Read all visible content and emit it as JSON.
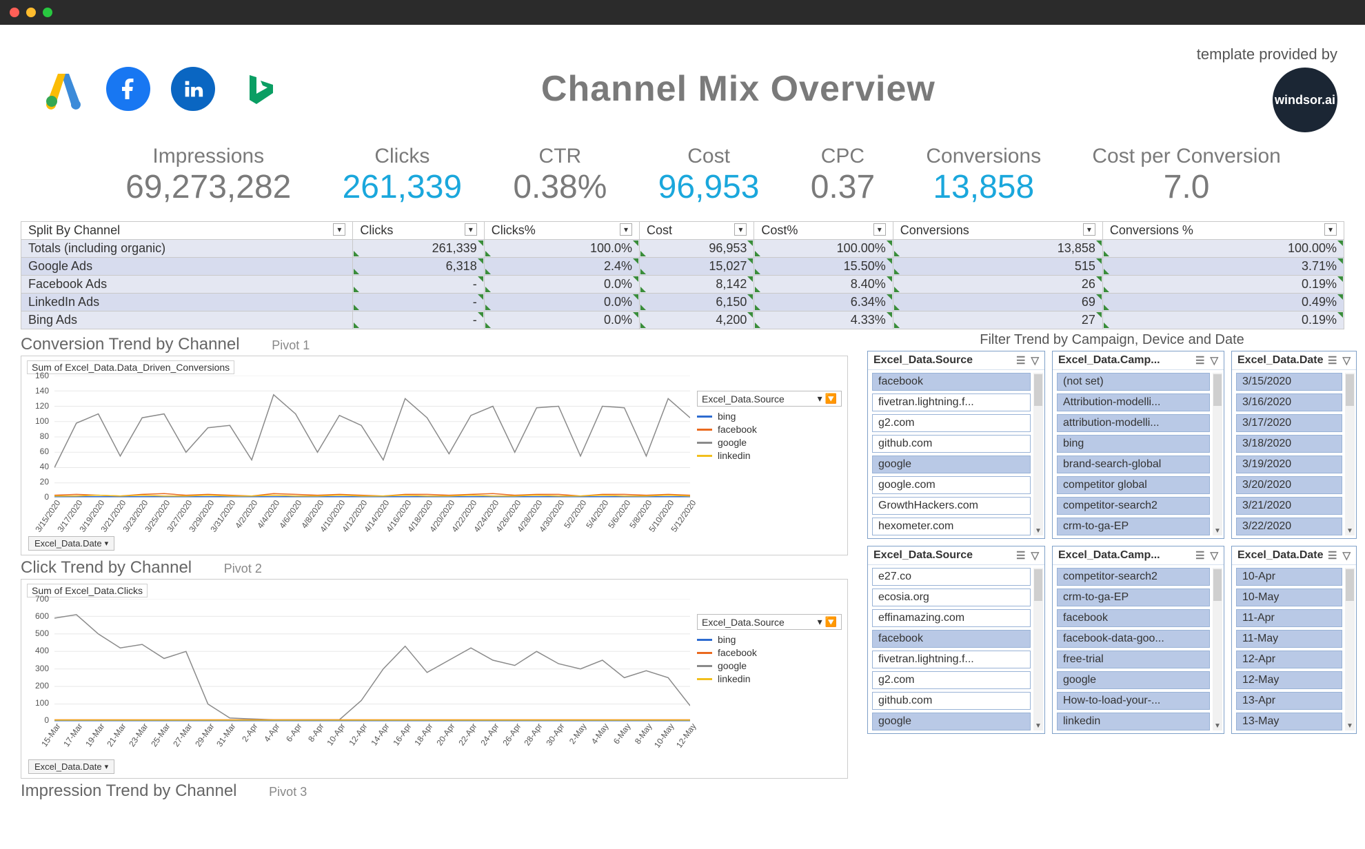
{
  "window": {
    "title": "Channel Mix Overview",
    "provided_label": "template provided by",
    "badge": "windsor.ai"
  },
  "kpis": [
    {
      "label": "Impressions",
      "value": "69,273,282",
      "blue": false
    },
    {
      "label": "Clicks",
      "value": "261,339",
      "blue": true
    },
    {
      "label": "CTR",
      "value": "0.38%",
      "blue": false
    },
    {
      "label": "Cost",
      "value": "96,953",
      "blue": true
    },
    {
      "label": "CPC",
      "value": "0.37",
      "blue": false
    },
    {
      "label": "Conversions",
      "value": "13,858",
      "blue": true
    },
    {
      "label": "Cost per Conversion",
      "value": "7.0",
      "blue": false
    }
  ],
  "table": {
    "headers": [
      "Split By Channel",
      "Clicks",
      "Clicks%",
      "Cost",
      "Cost%",
      "Conversions",
      "Conversions %"
    ],
    "rows": [
      {
        "c": [
          "Totals (including organic)",
          "261,339",
          "100.0%",
          "96,953",
          "100.00%",
          "13,858",
          "100.00%"
        ]
      },
      {
        "c": [
          "Google Ads",
          "6,318",
          "2.4%",
          "15,027",
          "15.50%",
          "515",
          "3.71%"
        ]
      },
      {
        "c": [
          "Facebook Ads",
          "-",
          "0.0%",
          "8,142",
          "8.40%",
          "26",
          "0.19%"
        ]
      },
      {
        "c": [
          "LinkedIn Ads",
          "-",
          "0.0%",
          "6,150",
          "6.34%",
          "69",
          "0.49%"
        ]
      },
      {
        "c": [
          "Bing Ads",
          "-",
          "0.0%",
          "4,200",
          "4.33%",
          "27",
          "0.19%"
        ]
      }
    ]
  },
  "legend_header": "Excel_Data.Source",
  "legend": [
    {
      "name": "bing",
      "color": "#2d6bd0"
    },
    {
      "name": "facebook",
      "color": "#ea6a1f"
    },
    {
      "name": "google",
      "color": "#8a8a8a"
    },
    {
      "name": "linkedin",
      "color": "#f2bf1c"
    }
  ],
  "chart1": {
    "title": "Conversion Trend by Channel",
    "pivot": "Pivot 1",
    "sub": "Sum of Excel_Data.Data_Driven_Conversions",
    "pill": "Excel_Data.Date"
  },
  "chart2": {
    "title": "Click Trend by Channel",
    "pivot": "Pivot 2",
    "sub": "Sum of Excel_Data.Clicks",
    "pill": "Excel_Data.Date"
  },
  "chart3": {
    "title": "Impression Trend by Channel",
    "pivot": "Pivot 3"
  },
  "filters_header": "Filter Trend by Campaign, Device and Date",
  "slicers_top": [
    {
      "title": "Excel_Data.Source",
      "scroll": true,
      "items": [
        {
          "t": "facebook",
          "sel": true
        },
        {
          "t": "fivetran.lightning.f...",
          "sel": false
        },
        {
          "t": "g2.com",
          "sel": false
        },
        {
          "t": "github.com",
          "sel": false
        },
        {
          "t": "google",
          "sel": true
        },
        {
          "t": "google.com",
          "sel": false
        },
        {
          "t": "GrowthHackers.com",
          "sel": false
        },
        {
          "t": "hexometer.com",
          "sel": false
        }
      ]
    },
    {
      "title": "Excel_Data.Camp...",
      "scroll": true,
      "items": [
        {
          "t": "(not set)",
          "sel": true
        },
        {
          "t": "Attribution-modelli...",
          "sel": true
        },
        {
          "t": "attribution-modelli...",
          "sel": true
        },
        {
          "t": "bing",
          "sel": true
        },
        {
          "t": "brand-search-global",
          "sel": true
        },
        {
          "t": "competitor global",
          "sel": true
        },
        {
          "t": "competitor-search2",
          "sel": true
        },
        {
          "t": "crm-to-ga-EP",
          "sel": true
        }
      ]
    },
    {
      "title": "Excel_Data.Date",
      "scroll": true,
      "items": [
        {
          "t": "3/15/2020",
          "sel": true
        },
        {
          "t": "3/16/2020",
          "sel": true
        },
        {
          "t": "3/17/2020",
          "sel": true
        },
        {
          "t": "3/18/2020",
          "sel": true
        },
        {
          "t": "3/19/2020",
          "sel": true
        },
        {
          "t": "3/20/2020",
          "sel": true
        },
        {
          "t": "3/21/2020",
          "sel": true
        },
        {
          "t": "3/22/2020",
          "sel": true
        }
      ]
    }
  ],
  "slicers_bot": [
    {
      "title": "Excel_Data.Source",
      "scroll": true,
      "items": [
        {
          "t": "e27.co",
          "sel": false
        },
        {
          "t": "ecosia.org",
          "sel": false
        },
        {
          "t": "effinamazing.com",
          "sel": false
        },
        {
          "t": "facebook",
          "sel": true
        },
        {
          "t": "fivetran.lightning.f...",
          "sel": false
        },
        {
          "t": "g2.com",
          "sel": false
        },
        {
          "t": "github.com",
          "sel": false
        },
        {
          "t": "google",
          "sel": true
        }
      ]
    },
    {
      "title": "Excel_Data.Camp...",
      "scroll": true,
      "items": [
        {
          "t": "competitor-search2",
          "sel": true
        },
        {
          "t": "crm-to-ga-EP",
          "sel": true
        },
        {
          "t": "facebook",
          "sel": true
        },
        {
          "t": "facebook-data-goo...",
          "sel": true
        },
        {
          "t": "free-trial",
          "sel": true
        },
        {
          "t": "google",
          "sel": true
        },
        {
          "t": "How-to-load-your-...",
          "sel": true
        },
        {
          "t": "linkedin",
          "sel": true
        }
      ]
    },
    {
      "title": "Excel_Data.Date",
      "scroll": true,
      "items": [
        {
          "t": "10-Apr",
          "sel": true
        },
        {
          "t": "10-May",
          "sel": true
        },
        {
          "t": "11-Apr",
          "sel": true
        },
        {
          "t": "11-May",
          "sel": true
        },
        {
          "t": "12-Apr",
          "sel": true
        },
        {
          "t": "12-May",
          "sel": true
        },
        {
          "t": "13-Apr",
          "sel": true
        },
        {
          "t": "13-May",
          "sel": true
        }
      ]
    }
  ],
  "chart_data": [
    {
      "id": "conversion_trend",
      "type": "line",
      "ylim": [
        0,
        160
      ],
      "yticks": [
        0,
        20,
        40,
        60,
        80,
        100,
        120,
        140,
        160
      ],
      "x": [
        "3/15/2020",
        "3/17/2020",
        "3/19/2020",
        "3/21/2020",
        "3/23/2020",
        "3/25/2020",
        "3/27/2020",
        "3/29/2020",
        "3/31/2020",
        "4/2/2020",
        "4/4/2020",
        "4/6/2020",
        "4/8/2020",
        "4/10/2020",
        "4/12/2020",
        "4/14/2020",
        "4/16/2020",
        "4/18/2020",
        "4/20/2020",
        "4/22/2020",
        "4/24/2020",
        "4/26/2020",
        "4/28/2020",
        "4/30/2020",
        "5/2/2020",
        "5/4/2020",
        "5/6/2020",
        "5/8/2020",
        "5/10/2020",
        "5/12/2020"
      ],
      "series": [
        {
          "name": "google",
          "color": "#8a8a8a",
          "values": [
            40,
            98,
            110,
            55,
            105,
            110,
            60,
            92,
            95,
            50,
            135,
            110,
            60,
            108,
            95,
            50,
            130,
            105,
            58,
            108,
            120,
            60,
            118,
            120,
            55,
            120,
            118,
            55,
            130,
            105
          ]
        },
        {
          "name": "bing",
          "color": "#2d6bd0",
          "values": [
            2,
            2,
            2,
            2,
            2,
            2,
            2,
            2,
            2,
            2,
            2,
            2,
            2,
            2,
            2,
            2,
            2,
            2,
            2,
            2,
            2,
            2,
            2,
            2,
            2,
            2,
            2,
            2,
            2,
            2
          ]
        },
        {
          "name": "facebook",
          "color": "#ea6a1f",
          "values": [
            4,
            5,
            4,
            3,
            5,
            6,
            4,
            5,
            4,
            3,
            6,
            5,
            4,
            5,
            4,
            3,
            5,
            5,
            4,
            5,
            6,
            4,
            5,
            5,
            3,
            5,
            5,
            4,
            5,
            4
          ]
        },
        {
          "name": "linkedin",
          "color": "#f2bf1c",
          "values": [
            3,
            3,
            4,
            3,
            4,
            3,
            3,
            4,
            3,
            3,
            4,
            3,
            3,
            4,
            3,
            3,
            4,
            3,
            3,
            4,
            3,
            3,
            4,
            3,
            3,
            4,
            3,
            3,
            4,
            3
          ]
        }
      ]
    },
    {
      "id": "click_trend",
      "type": "line",
      "ylim": [
        0,
        700
      ],
      "yticks": [
        0,
        100,
        200,
        300,
        400,
        500,
        600,
        700
      ],
      "x": [
        "15-Mar",
        "17-Mar",
        "19-Mar",
        "21-Mar",
        "23-Mar",
        "25-Mar",
        "27-Mar",
        "29-Mar",
        "31-Mar",
        "2-Apr",
        "4-Apr",
        "6-Apr",
        "8-Apr",
        "10-Apr",
        "12-Apr",
        "14-Apr",
        "16-Apr",
        "18-Apr",
        "20-Apr",
        "22-Apr",
        "24-Apr",
        "26-Apr",
        "28-Apr",
        "30-Apr",
        "2-May",
        "4-May",
        "6-May",
        "8-May",
        "10-May",
        "12-May"
      ],
      "series": [
        {
          "name": "google",
          "color": "#8a8a8a",
          "values": [
            590,
            610,
            500,
            420,
            440,
            360,
            400,
            100,
            20,
            15,
            10,
            10,
            10,
            10,
            120,
            300,
            430,
            280,
            350,
            420,
            350,
            320,
            400,
            330,
            300,
            350,
            250,
            290,
            250,
            90
          ]
        },
        {
          "name": "bing",
          "color": "#2d6bd0",
          "values": [
            5,
            5,
            5,
            5,
            5,
            5,
            5,
            5,
            5,
            5,
            5,
            5,
            5,
            5,
            5,
            5,
            5,
            5,
            5,
            5,
            5,
            5,
            5,
            5,
            5,
            5,
            5,
            5,
            5,
            5
          ]
        },
        {
          "name": "facebook",
          "color": "#ea6a1f",
          "values": [
            10,
            10,
            10,
            10,
            10,
            10,
            10,
            10,
            10,
            10,
            10,
            10,
            10,
            10,
            10,
            10,
            10,
            10,
            10,
            10,
            10,
            10,
            10,
            10,
            10,
            10,
            10,
            10,
            10,
            10
          ]
        },
        {
          "name": "linkedin",
          "color": "#f2bf1c",
          "values": [
            8,
            8,
            8,
            8,
            8,
            8,
            8,
            8,
            8,
            8,
            8,
            8,
            8,
            8,
            8,
            8,
            8,
            8,
            8,
            8,
            8,
            8,
            8,
            8,
            8,
            8,
            8,
            8,
            8,
            8
          ]
        }
      ]
    }
  ]
}
